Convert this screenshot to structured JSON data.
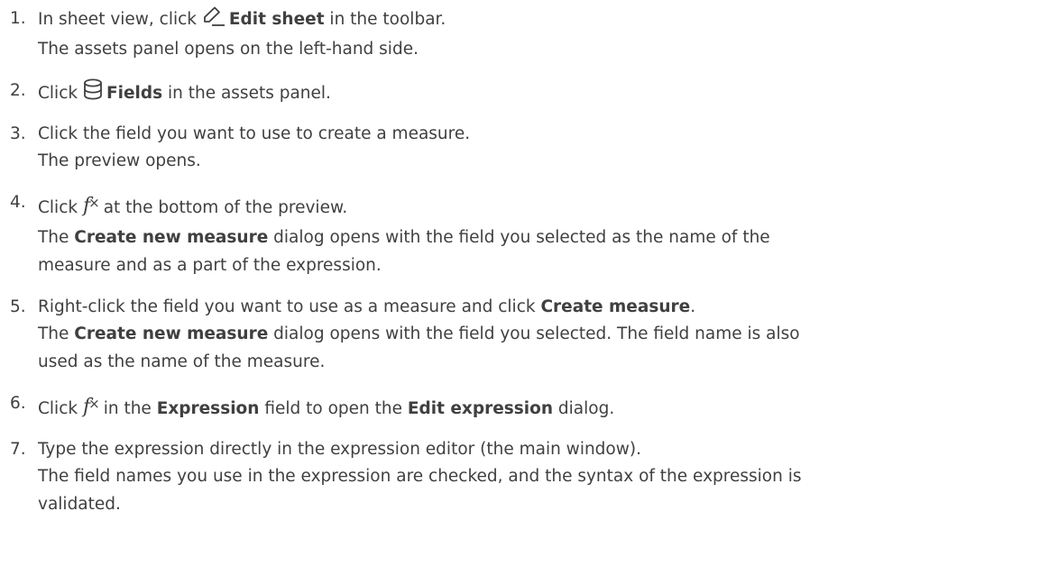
{
  "steps": [
    {
      "number": "1.",
      "parts": {
        "pre": "In sheet view, click ",
        "icon": "pencil-icon",
        "bold": "Edit sheet",
        "post": " in the toolbar."
      },
      "sub": [
        "The assets panel opens on the left-hand side."
      ]
    },
    {
      "number": "2.",
      "parts": {
        "pre": "Click ",
        "icon": "database-icon",
        "bold": "Fields",
        "post": " in the assets panel."
      },
      "sub": []
    },
    {
      "number": "3.",
      "text": "Click the field you want to use to create a measure.",
      "sub": [
        "The preview opens."
      ]
    },
    {
      "number": "4.",
      "parts": {
        "pre": "Click ",
        "icon": "fx-icon",
        "post": "at the bottom of the preview."
      },
      "sub_bold": "Create new measure",
      "sub_pre": "The ",
      "sub_post": " dialog opens with the field you selected as the name of the",
      "sub_cont": "measure and as a part of the expression."
    },
    {
      "number": "5.",
      "parts": {
        "pre": "Right-click the field you want to use as a measure and click ",
        "bold": "Create measure",
        "post": "."
      },
      "sub_pre": "The ",
      "sub_bold": "Create new measure",
      "sub_post": " dialog opens with the field you selected. The field name is also",
      "sub_cont": "used as the name of the measure."
    },
    {
      "number": "6.",
      "parts": {
        "pre": "Click ",
        "icon": "fx-icon",
        "mid_pre": "in the ",
        "bold1": "Expression",
        "mid": " field to open the ",
        "bold2": "Edit expression",
        "post": " dialog."
      }
    },
    {
      "number": "7.",
      "text": "Type the expression directly in the expression editor (the main window).",
      "sub": [
        "The field names you use in the expression are checked, and the syntax of the expression is",
        "validated."
      ]
    }
  ],
  "icons": {
    "fx_f": "f",
    "fx_x": "×"
  }
}
